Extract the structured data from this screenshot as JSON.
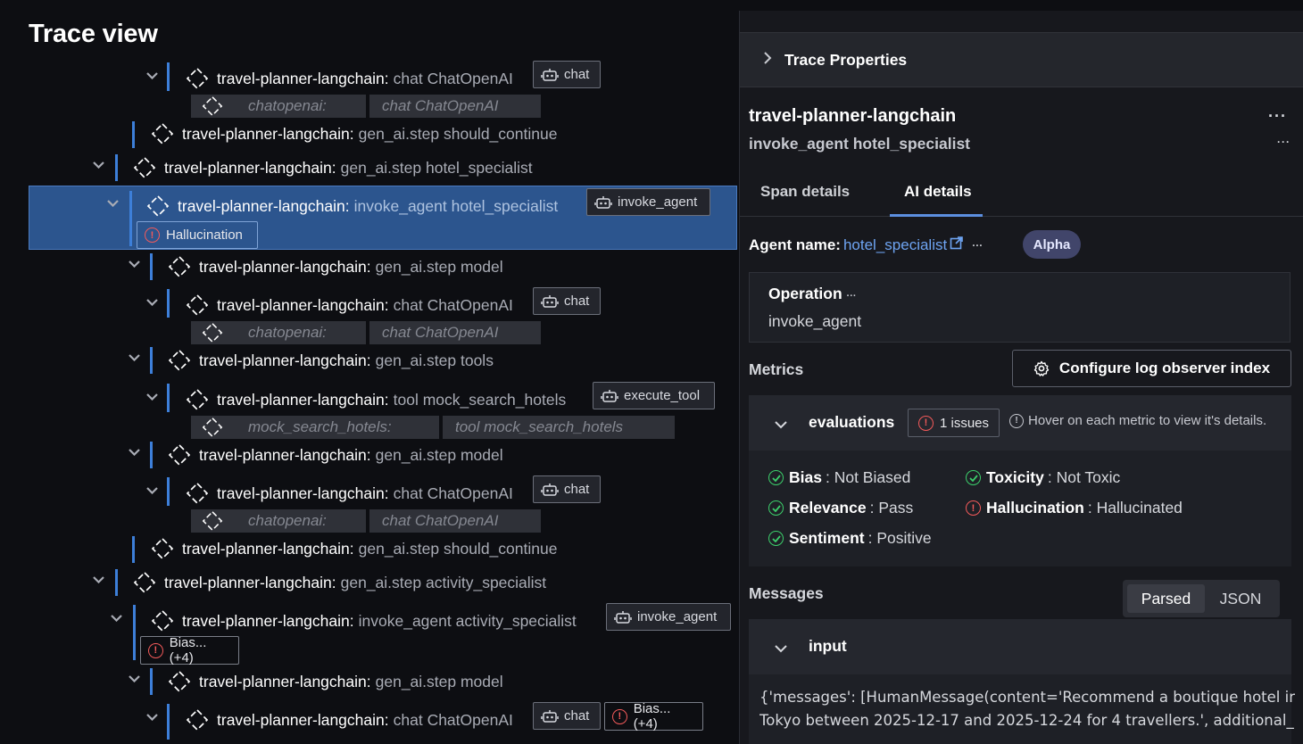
{
  "page_title": "Trace view",
  "tree": {
    "service": "travel-planner-langchain:",
    "rows": [
      {
        "op": "chat ChatOpenAI",
        "badge": "chat",
        "sub": [
          "chatopenai:",
          "chat ChatOpenAI"
        ]
      },
      {
        "op": "gen_ai.step should_continue"
      },
      {
        "op": "gen_ai.step hotel_specialist"
      },
      {
        "op": "invoke_agent hotel_specialist",
        "badge": "invoke_agent",
        "issue": "Hallucination",
        "selected": true
      },
      {
        "op": "gen_ai.step model"
      },
      {
        "op": "chat ChatOpenAI",
        "badge": "chat",
        "sub": [
          "chatopenai:",
          "chat ChatOpenAI"
        ]
      },
      {
        "op": "gen_ai.step tools"
      },
      {
        "op": "tool mock_search_hotels",
        "badge": "execute_tool",
        "sub": [
          "mock_search_hotels:",
          "tool mock_search_hotels"
        ]
      },
      {
        "op": "gen_ai.step model"
      },
      {
        "op": "chat ChatOpenAI",
        "badge": "chat",
        "sub": [
          "chatopenai:",
          "chat ChatOpenAI"
        ]
      },
      {
        "op": "gen_ai.step should_continue"
      },
      {
        "op": "gen_ai.step activity_specialist"
      },
      {
        "op": "invoke_agent activity_specialist",
        "badge": "invoke_agent",
        "issue": "Bias...(+4)"
      },
      {
        "op": "gen_ai.step model"
      },
      {
        "op": "chat ChatOpenAI",
        "badge": "chat",
        "issue": "Bias...(+4)"
      }
    ]
  },
  "panel": {
    "header": "Trace Properties",
    "title": "travel-planner-langchain",
    "subtitle": "invoke_agent hotel_specialist",
    "tabs": [
      "Span details",
      "AI details"
    ],
    "active_tab": "AI details",
    "agent_label": "Agent name:",
    "agent_value": "hotel_specialist",
    "alpha": "Alpha",
    "operation_label": "Operation",
    "operation_value": "invoke_agent",
    "metrics_label": "Metrics",
    "configure_button": "Configure log observer index",
    "evaluations_label": "evaluations",
    "issues_count": "1 issues",
    "hover_hint": "Hover on each metric to view it's details.",
    "metrics": [
      {
        "name": "Bias",
        "value": "Not Biased",
        "status": "ok"
      },
      {
        "name": "Toxicity",
        "value": "Not Toxic",
        "status": "ok"
      },
      {
        "name": "Relevance",
        "value": "Pass",
        "status": "ok"
      },
      {
        "name": "Hallucination",
        "value": "Hallucinated",
        "status": "error"
      },
      {
        "name": "Sentiment",
        "value": "Positive",
        "status": "ok"
      }
    ],
    "messages_label": "Messages",
    "format_options": [
      "Parsed",
      "JSON"
    ],
    "format_selected": "Parsed",
    "input_label": "input",
    "input_lines": [
      "{'messages': [HumanMessage(content='Recommend a boutique hotel in",
      "Tokyo between 2025-12-17 and 2025-12-24 for 4 travellers.', additional_"
    ]
  },
  "colors": {
    "accent": "#3d7fd9",
    "selected": "#2c558e",
    "error": "#f35a5a",
    "ok": "#3ccf6b"
  }
}
